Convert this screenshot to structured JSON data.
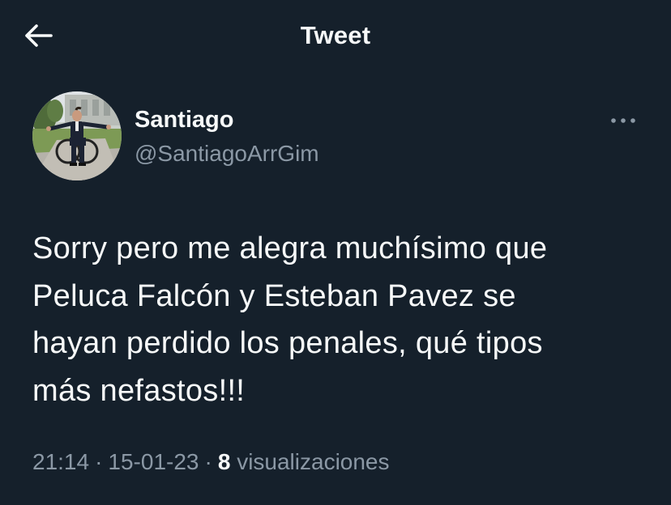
{
  "header": {
    "title": "Tweet",
    "back_icon": "arrow-left-icon"
  },
  "author": {
    "name": "Santiago",
    "handle": "@SantiagoArrGim",
    "avatar_icon": "profile-photo"
  },
  "more_icon": "more-horizontal-icon",
  "tweet": {
    "lines": [
      "Sorry pero me alegra muchísimo que",
      "Peluca Falcón y Esteban Pavez se",
      "hayan perdido los penales, qué tipos",
      "más nefastos!!!"
    ]
  },
  "meta": {
    "time": "21:14",
    "separator": "·",
    "date": "15-01-23",
    "views_count": "8",
    "views_label": "visualizaciones"
  },
  "colors": {
    "background": "#15202b",
    "text_primary": "#f7f9f9",
    "text_secondary": "#8b98a5"
  }
}
